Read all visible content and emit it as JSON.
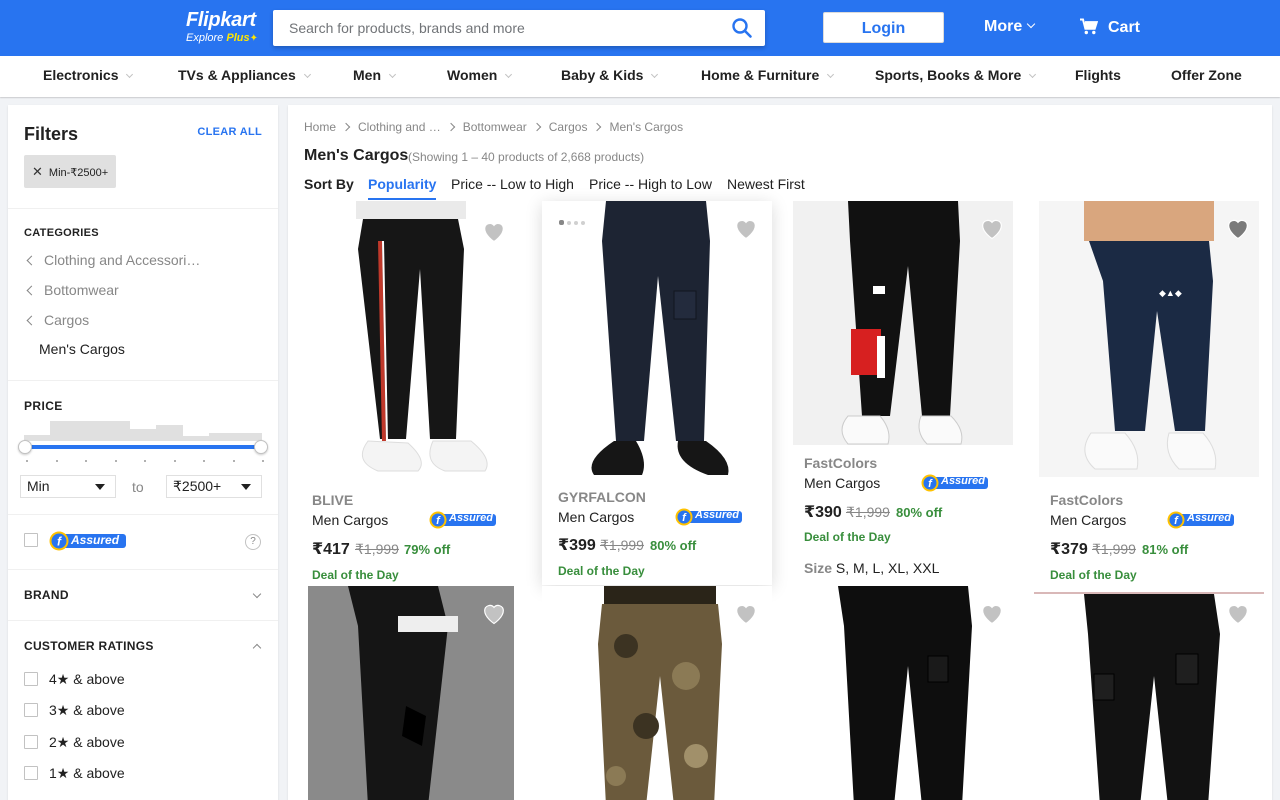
{
  "header": {
    "logo_main": "Flipkart",
    "logo_sub": "Explore",
    "logo_plus": "Plus",
    "search_placeholder": "Search for products, brands and more",
    "login": "Login",
    "more": "More",
    "cart": "Cart"
  },
  "categories": [
    "Electronics",
    "TVs & Appliances",
    "Men",
    "Women",
    "Baby & Kids",
    "Home & Furniture",
    "Sports, Books & More",
    "Flights",
    "Offer Zone"
  ],
  "filters": {
    "title": "Filters",
    "clear_all": "CLEAR ALL",
    "chip": "Min-₹2500+",
    "categories_head": "CATEGORIES",
    "category_path": [
      "Clothing and Accessori…",
      "Bottomwear",
      "Cargos"
    ],
    "current_category": "Men's Cargos",
    "price_head": "PRICE",
    "price_min": "Min",
    "price_to": "to",
    "price_max": "₹2500+",
    "assured_label": "Assured",
    "help": "?",
    "brand_head": "BRAND",
    "ratings_head": "CUSTOMER RATINGS",
    "ratings": [
      "4★ & above",
      "3★ & above",
      "2★ & above",
      "1★ & above"
    ],
    "histogram": [
      0.3,
      1.0,
      1.0,
      1.0,
      0.6,
      0.8,
      0.25,
      0.4,
      0.4
    ]
  },
  "main": {
    "breadcrumb": [
      "Home",
      "Clothing and …",
      "Bottomwear",
      "Cargos",
      "Men's Cargos"
    ],
    "title": "Men's Cargos",
    "showing": "(Showing 1 – 40 products of 2,668 products)",
    "sort_by": "Sort By",
    "sort_options": [
      "Popularity",
      "Price -- Low to High",
      "Price -- High to Low",
      "Newest First"
    ]
  },
  "products": [
    {
      "brand": "BLIVE",
      "name": "Men Cargos",
      "price": "₹417",
      "mrp": "₹1,999",
      "off": "79% off",
      "deal": "Deal of the Day",
      "assured": "Assured"
    },
    {
      "brand": "GYRFALCON",
      "name": "Men Cargos",
      "price": "₹399",
      "mrp": "₹1,999",
      "off": "80% off",
      "deal": "Deal of the Day",
      "assured": "Assured"
    },
    {
      "brand": "FastColors",
      "name": "Men Cargos",
      "price": "₹390",
      "mrp": "₹1,999",
      "off": "80% off",
      "deal": "Deal of the Day",
      "assured": "Assured",
      "size_label": "Size",
      "sizes": "S, M, L, XL, XXL"
    },
    {
      "brand": "FastColors",
      "name": "Men Cargos",
      "price": "₹379",
      "mrp": "₹1,999",
      "off": "81% off",
      "deal": "Deal of the Day",
      "assured": "Assured"
    }
  ],
  "colors": {
    "brand_blue": "#2874f0",
    "brand_yellow": "#ffe500",
    "offer_green": "#388e3c"
  }
}
